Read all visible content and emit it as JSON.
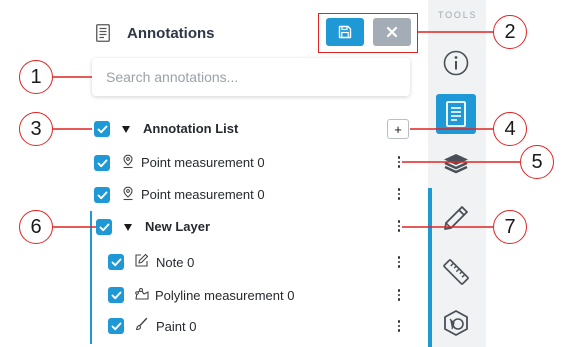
{
  "panel": {
    "title": "Annotations",
    "save_icon": "floppy-disk-icon",
    "close_icon": "x-icon",
    "search_placeholder": "Search annotations..."
  },
  "list": {
    "group_label": "Annotation List",
    "add_label": "+",
    "items": [
      {
        "label": "Point measurement 0",
        "icon": "map-pin-icon",
        "checked": true
      },
      {
        "label": "Point measurement 0",
        "icon": "map-pin-icon",
        "checked": true
      }
    ],
    "layer": {
      "label": "New Layer",
      "checked": true,
      "items": [
        {
          "label": "Note 0",
          "icon": "note-edit-icon",
          "checked": true
        },
        {
          "label": "Polyline measurement 0",
          "icon": "polyline-icon",
          "checked": true
        },
        {
          "label": "Paint 0",
          "icon": "brush-icon",
          "checked": true
        }
      ]
    }
  },
  "tools": {
    "label": "TOOLS",
    "items": [
      {
        "icon": "info-icon",
        "active": false
      },
      {
        "icon": "annotations-document-icon",
        "active": true
      },
      {
        "icon": "layers-icon",
        "active": false
      },
      {
        "icon": "pencil-icon",
        "active": false
      },
      {
        "icon": "ruler-icon",
        "active": false
      },
      {
        "icon": "shape-icon",
        "active": false
      }
    ]
  },
  "callouts": [
    "1",
    "2",
    "3",
    "4",
    "5",
    "6",
    "7"
  ],
  "colors": {
    "accent": "#1f98d6",
    "close_button": "#a4acb5",
    "callout": "#e02424",
    "tools_bg": "#f0f2f4"
  }
}
